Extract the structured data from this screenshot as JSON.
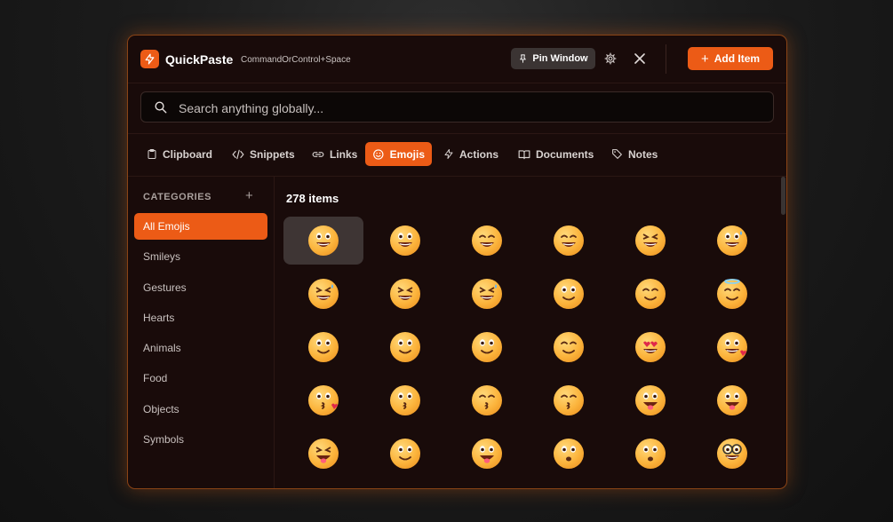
{
  "app": {
    "name": "QuickPaste",
    "shortcut": "CommandOrControl+Space"
  },
  "titlebar": {
    "pin_label": "Pin Window",
    "add_label": "Add Item"
  },
  "search": {
    "placeholder": "Search anything globally..."
  },
  "tabs": [
    {
      "label": "Clipboard",
      "icon": "clipboard-icon"
    },
    {
      "label": "Snippets",
      "icon": "code-icon"
    },
    {
      "label": "Links",
      "icon": "link-icon"
    },
    {
      "label": "Emojis",
      "icon": "smiley-icon",
      "active": true
    },
    {
      "label": "Actions",
      "icon": "lightning-icon"
    },
    {
      "label": "Documents",
      "icon": "book-icon"
    },
    {
      "label": "Notes",
      "icon": "tag-icon"
    }
  ],
  "sidebar": {
    "header": "CATEGORIES",
    "add": "+",
    "items": [
      {
        "label": "All Emojis",
        "active": true
      },
      {
        "label": "Smileys"
      },
      {
        "label": "Gestures"
      },
      {
        "label": "Hearts"
      },
      {
        "label": "Animals"
      },
      {
        "label": "Food"
      },
      {
        "label": "Objects"
      },
      {
        "label": "Symbols"
      }
    ]
  },
  "main": {
    "count_label": "278 items",
    "emojis": [
      "grinning-face",
      "grinning-face-big-eyes",
      "grinning-face-smiling-eyes",
      "beaming-face",
      "grinning-squinting-face",
      "grinning-face-sweat",
      "tears-of-joy",
      "rolling-on-floor-laughing",
      "face-holding-back-tears",
      "smiling-face",
      "smiling-face-smiling-eyes",
      "smiling-face-halo",
      "slightly-smiling-face",
      "upside-down-face",
      "winking-face",
      "relieved-face",
      "heart-eyes",
      "smiling-face-hearts",
      "face-blowing-kiss",
      "kissing-face",
      "kissing-face-smiling-eyes",
      "kissing-face-closed-eyes",
      "face-savoring-food",
      "face-with-tongue",
      "squinting-face-tongue",
      "winking-face-tongue",
      "zany-face",
      "face-with-open-mouth",
      "face-with-monocle",
      "nerd-face"
    ],
    "selected_index": 0
  },
  "colors": {
    "accent": "#ec5b16",
    "window_bg": "#190b0a",
    "border": "#8a4416"
  }
}
